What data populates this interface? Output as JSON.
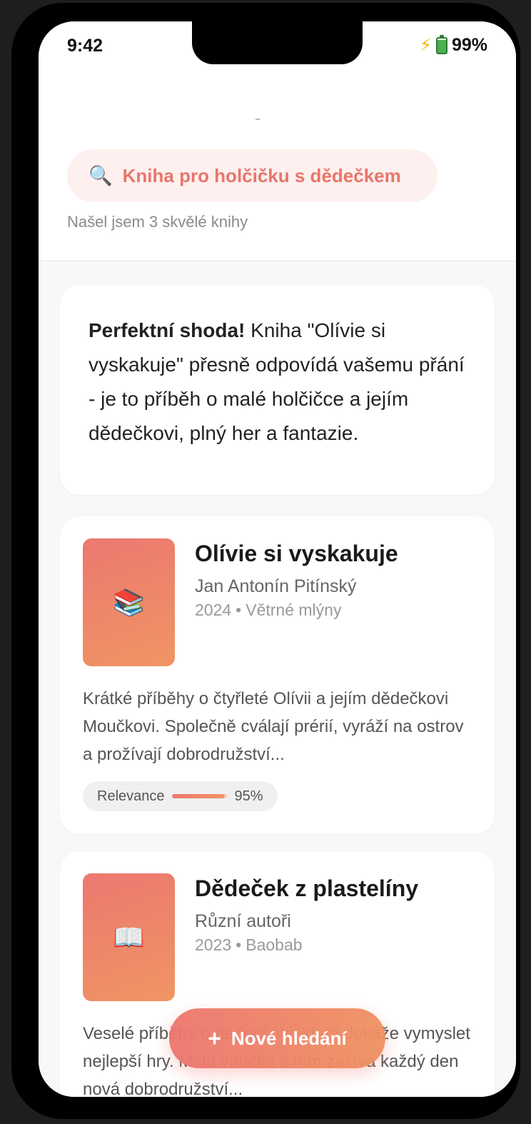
{
  "status_bar": {
    "time": "9:42",
    "battery_percent": "99%",
    "icons": [
      "bolt-icon",
      "battery-icon"
    ]
  },
  "search": {
    "query": "Kniha pro holčičku s dědečkem",
    "result_count": "Našel jsem 3 skvělé knihy",
    "icon": "search-icon"
  },
  "ai_summary": {
    "bold": "Perfektní shoda!",
    "text": " Kniha \"Olívie si vyskakuje\" přesně odpovídá vašemu přání - je to příběh o malé holčičce a jejím dědečkovi, plný her a fantazie."
  },
  "books": [
    {
      "title": "Olívie si vyskakuje",
      "author": "Jan Antonín Pitínský",
      "year": "2024",
      "publisher": "Větrné mlýny",
      "cover_icon": "books-icon",
      "cover_glyph": "📚",
      "description": "Krátké příběhy o čtyřleté Olívii a jejím dědečkovi Moučkovi. Společně cválají prérií, vyráží na ostrov a prožívají dobrodružství...",
      "relevance_label": "Relevance",
      "relevance": "95%",
      "relevance_fraction": 0.95
    },
    {
      "title": "Dědeček z plastelíny",
      "author": "Různí autoři",
      "year": "2023",
      "publisher": "Baobab",
      "cover_icon": "open-book-icon",
      "cover_glyph": "📖",
      "description": "Veselé příběhy o dědečkovi, který dokáže vymyslet nejlepší hry. Malá vnučka s ním zažívá každý den nová dobrodružství..."
    }
  ],
  "meta_separator": "•",
  "fab": {
    "label": "Nové hledání",
    "icon": "plus-icon",
    "glyph": "+"
  },
  "colors": {
    "accent": "#ee7770",
    "accent_end": "#f09262",
    "query_bg": "#fdf0ee",
    "query_text": "#e8766c"
  }
}
